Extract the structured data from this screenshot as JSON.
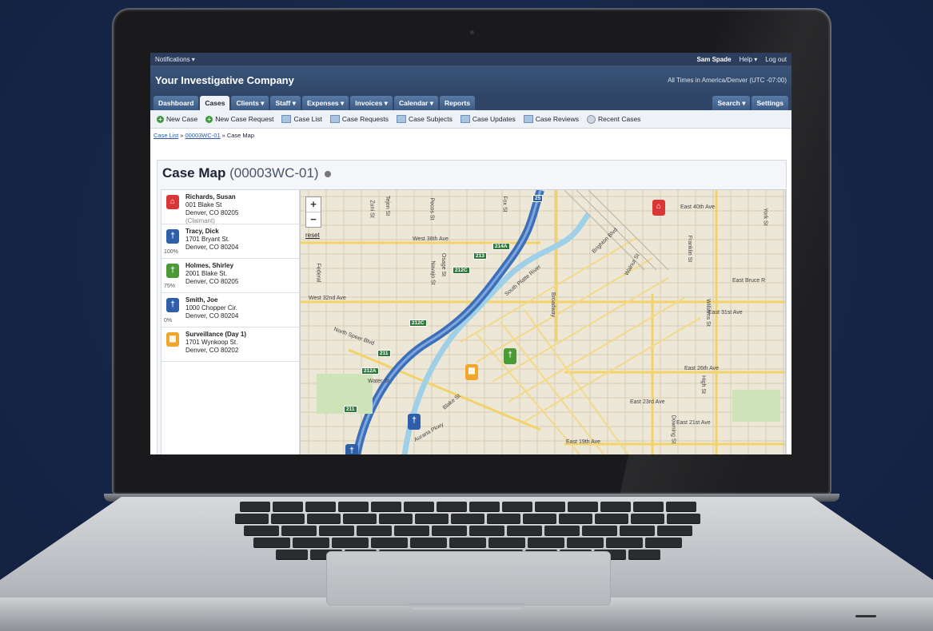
{
  "topbar": {
    "notifications_label": "Notifications ▾",
    "user_name": "Sam Spade",
    "help_label": "Help ▾",
    "logout_label": "Log out"
  },
  "header": {
    "company_name": "Your Investigative Company",
    "timezone_text": "All Times in America/Denver (UTC -07:00)"
  },
  "nav": {
    "tabs": [
      "Dashboard",
      "Cases",
      "Clients ▾",
      "Staff ▾",
      "Expenses ▾",
      "Invoices ▾",
      "Calendar ▾",
      "Reports"
    ],
    "active_tab": "Cases",
    "right_tabs": [
      "Search ▾",
      "Settings"
    ]
  },
  "subnav": {
    "items": [
      "New Case",
      "New Case Request",
      "Case List",
      "Case Requests",
      "Case Subjects",
      "Case Updates",
      "Case Reviews",
      "Recent Cases"
    ]
  },
  "breadcrumb": {
    "items": [
      "Case List",
      "00003WC-01",
      "Case Map"
    ],
    "separator": "»"
  },
  "page": {
    "title": "Case Map",
    "case_id": "(00003WC-01)"
  },
  "case_list": [
    {
      "name": "Richards, Susan",
      "line1": "001 Blake St",
      "line2": "Denver, CO 80205",
      "note": "(Claimant)",
      "pct": "",
      "color": "#d93636",
      "icon": "house-icon"
    },
    {
      "name": "Tracy, Dick",
      "line1": "1701 Bryant St.",
      "line2": "Denver, CO 80204",
      "note": "",
      "pct": "100%",
      "color": "#2f5fa8",
      "icon": "person-icon"
    },
    {
      "name": "Holmes, Shirley",
      "line1": "2001 Blake St.",
      "line2": "Denver, CO 80205",
      "note": "",
      "pct": "75%",
      "color": "#4c9a35",
      "icon": "person-icon"
    },
    {
      "name": "Smith, Joe",
      "line1": "1000 Chopper Cir.",
      "line2": "Denver, CO 80204",
      "note": "",
      "pct": "0%",
      "color": "#2f5fa8",
      "icon": "person-icon"
    },
    {
      "name": "Surveillance (Day 1)",
      "line1": "1701 Wynkoop St.",
      "line2": "Denver, CO 80202",
      "note": "",
      "pct": "",
      "color": "#f0a62a",
      "icon": "calendar-icon"
    }
  ],
  "map": {
    "zoom_in": "+",
    "zoom_out": "−",
    "reset_label": "reset",
    "labels": [
      "West 38th Ave",
      "East 40th Ave",
      "West 32nd Ave",
      "East 31st Ave",
      "East Bruce R",
      "North Speer Blvd",
      "Water St",
      "East 26th Ave",
      "East 23rd Ave",
      "East 21st Ave",
      "East 19th Ave",
      "South Platte River",
      "Brighton Blvd",
      "Broadway",
      "Federal",
      "Auraria Pkwy",
      "Blake St",
      "Downing St",
      "High St",
      "York St",
      "Franklin St",
      "Williams St",
      "Walnut St",
      "Tejon St",
      "Zuni St",
      "Pecos St",
      "Navajo St",
      "Fox St",
      "Osage St"
    ],
    "highways": [
      "25",
      "214A",
      "213",
      "212C",
      "212C",
      "211",
      "212A",
      "211"
    ]
  }
}
